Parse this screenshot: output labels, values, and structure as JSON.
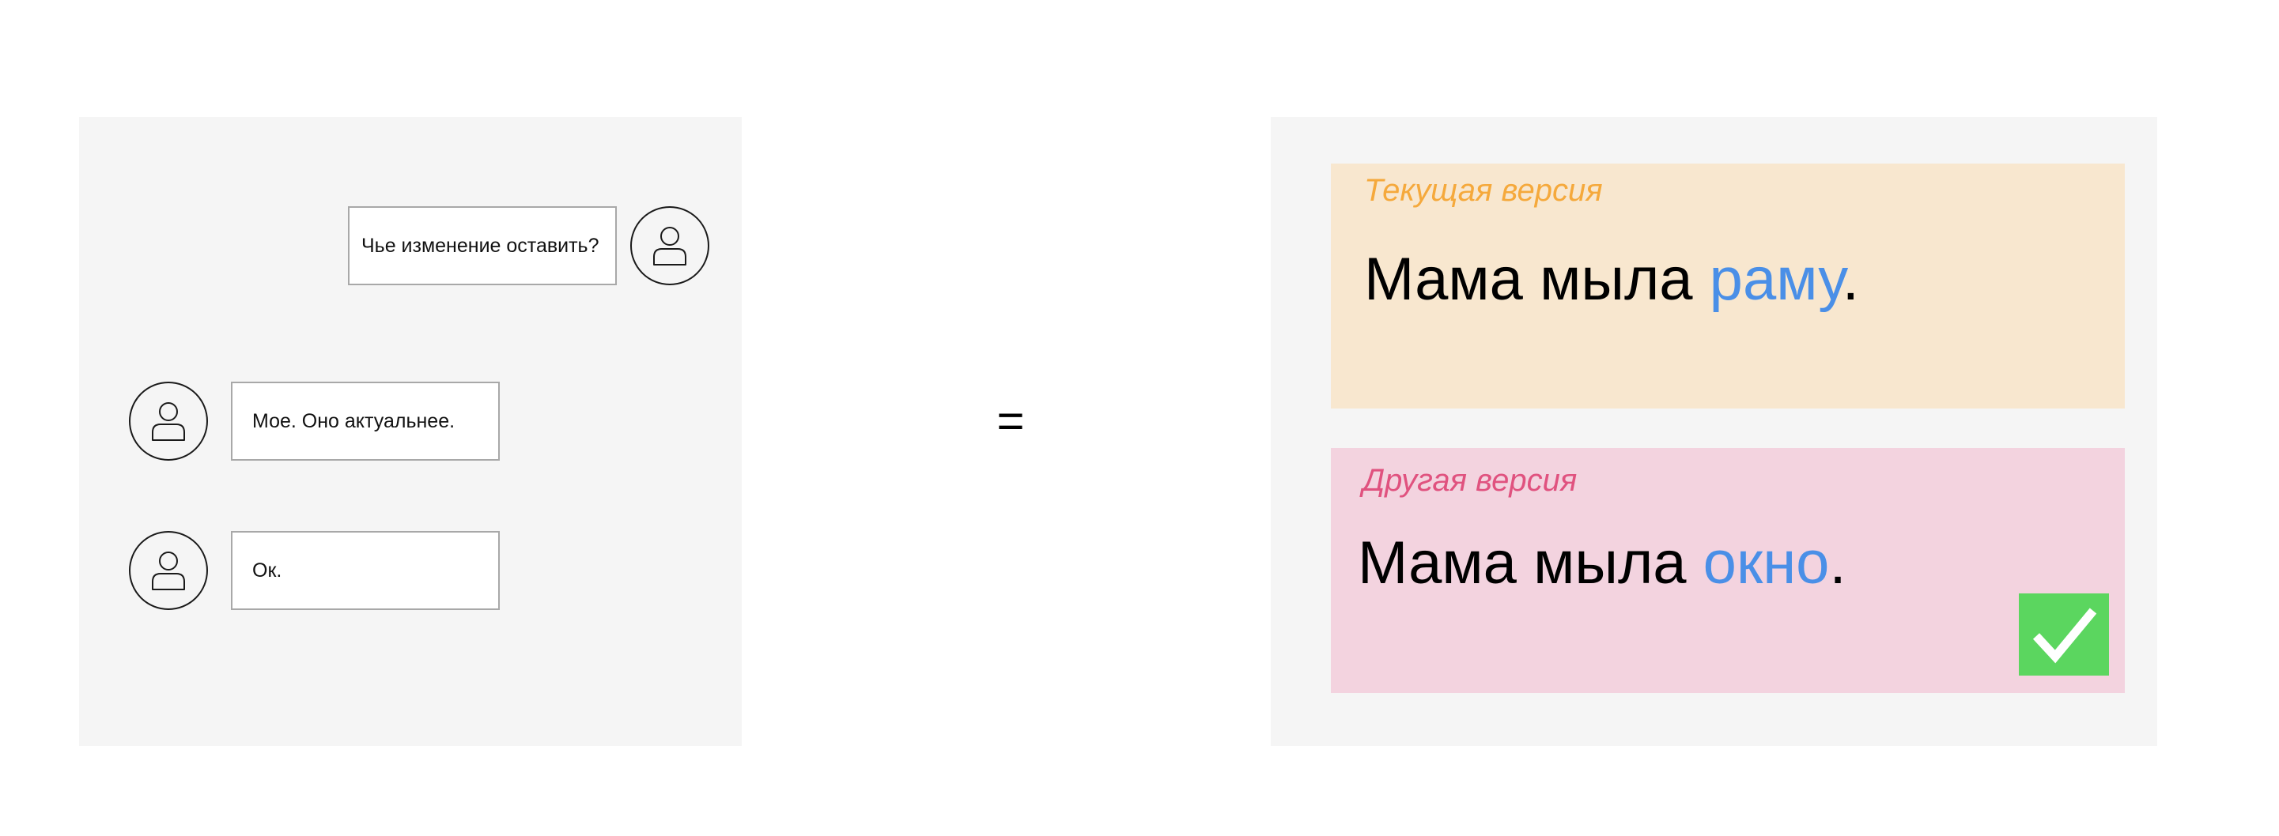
{
  "chat": {
    "messages": [
      {
        "side": "right",
        "text": "Чье изменение оставить?"
      },
      {
        "side": "left",
        "text": "Мое. Оно актуальнее."
      },
      {
        "side": "left",
        "text": "Ок."
      }
    ],
    "avatar_icon": "user-icon"
  },
  "equals": "=",
  "versions": {
    "current": {
      "label": "Текущая версия",
      "text_prefix": "Мама мыла ",
      "text_accent": "раму",
      "text_suffix": ".",
      "label_color": "#f5a93c",
      "background": "#f8e7cf"
    },
    "other": {
      "label": "Другая версия",
      "text_prefix": "Мама мыла ",
      "text_accent": "окно",
      "text_suffix": ".",
      "label_color": "#e0527f",
      "background": "#f3d3df",
      "selected": true,
      "selected_icon": "checkmark-icon"
    },
    "accent_color": "#4a8fe7",
    "check_color": "#5bd65f"
  }
}
